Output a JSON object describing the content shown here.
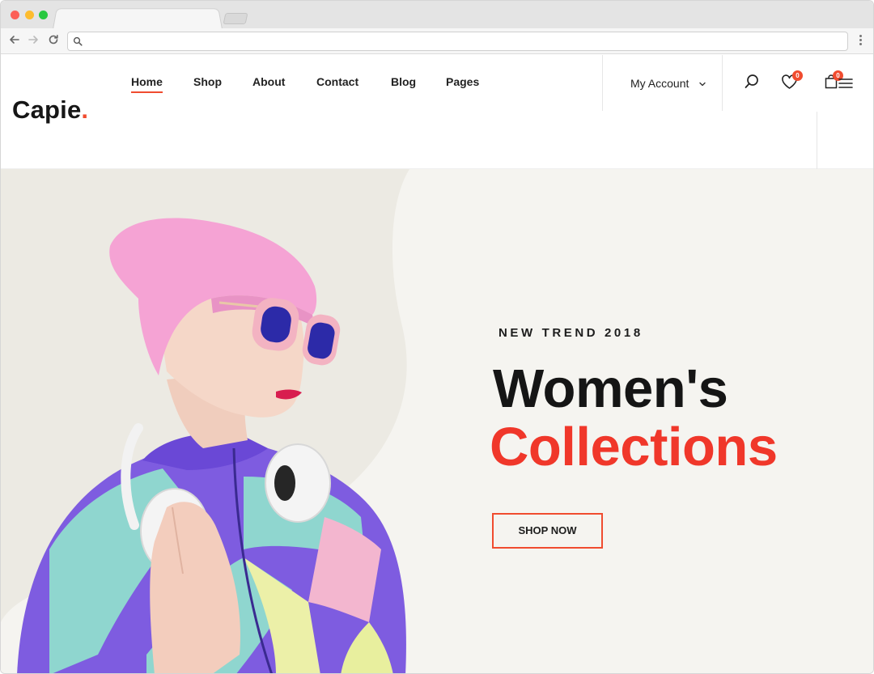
{
  "browser": {
    "url": ""
  },
  "site": {
    "logo_text": "Capie",
    "logo_dot": ".",
    "accent_color": "#f04c2f"
  },
  "nav": {
    "items": [
      {
        "label": "Home",
        "active": true
      },
      {
        "label": "Shop",
        "active": false
      },
      {
        "label": "About",
        "active": false
      },
      {
        "label": "Contact",
        "active": false
      },
      {
        "label": "Blog",
        "active": false
      },
      {
        "label": "Pages",
        "active": false
      }
    ],
    "account_label": "My Account",
    "wishlist_count": "0",
    "cart_count": "0"
  },
  "icons": {
    "search": "search-icon",
    "wishlist": "heart-icon",
    "cart": "shopping-bag-icon",
    "menu": "hamburger-icon",
    "chevron": "chevron-down-icon"
  },
  "hero": {
    "eyebrow": "NEW TREND 2018",
    "title_line1": "Women's",
    "title_line2": "Collections",
    "cta_label": "SHOP NOW",
    "title_color": "#151515",
    "highlight_color": "#f0372a"
  }
}
